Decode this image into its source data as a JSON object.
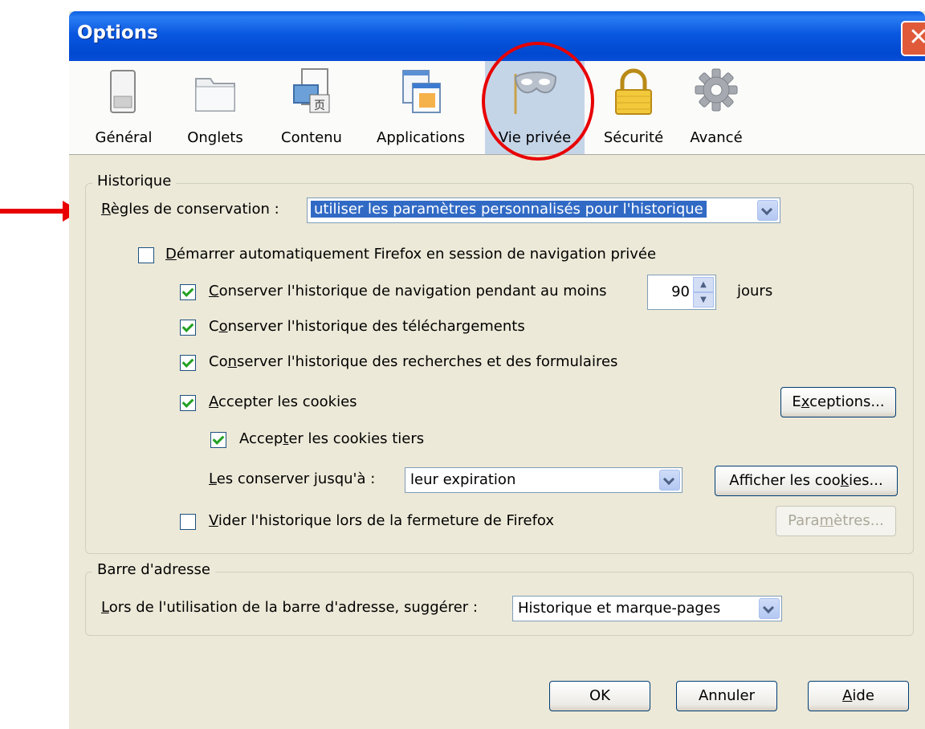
{
  "window": {
    "title": "Options",
    "close_glyph": "✕"
  },
  "tabs": [
    {
      "label": "Général",
      "icon": "general-icon"
    },
    {
      "label": "Onglets",
      "icon": "tabs-icon"
    },
    {
      "label": "Contenu",
      "icon": "content-icon"
    },
    {
      "label": "Applications",
      "icon": "applications-icon"
    },
    {
      "label": "Vie privée",
      "icon": "privacy-mask-icon",
      "selected": true
    },
    {
      "label": "Sécurité",
      "icon": "padlock-icon"
    },
    {
      "label": "Avancé",
      "icon": "gear-icon"
    }
  ],
  "history": {
    "legend": "Historique",
    "rules_label": "ègles de conservation :",
    "rules_u": "R",
    "rules_value": "utiliser les paramètres personnalisés pour l'historique",
    "autostart_u": "D",
    "autostart_label": "émarrer automatiquement Firefox en session de navigation privée",
    "autostart_checked": false,
    "keep_nav_u": "C",
    "keep_nav_label": "onserver l'historique de navigation pendant au moins",
    "keep_nav_checked": true,
    "days_value": "90",
    "days_unit": "jours",
    "keep_dl_pre": "C",
    "keep_dl_u": "o",
    "keep_dl_label": "nserver l'historique des téléchargements",
    "keep_dl_checked": true,
    "keep_search_pre": "Co",
    "keep_search_u": "n",
    "keep_search_label": "server l'historique des recherches et des formulaires",
    "keep_search_checked": true,
    "accept_cookies_u": "A",
    "accept_cookies_label": "ccepter les cookies",
    "accept_cookies_checked": true,
    "exceptions_pre": "E",
    "exceptions_u": "x",
    "exceptions_post": "ceptions...",
    "third_party_pre": "Accep",
    "third_party_u": "t",
    "third_party_label": "er les cookies tiers",
    "third_party_checked": true,
    "keep_until_u": "L",
    "keep_until_label": "es conserver jusqu'à :",
    "keep_until_value": "leur expiration",
    "show_cookies_pre": "Afficher les coo",
    "show_cookies_u": "k",
    "show_cookies_post": "ies...",
    "clear_u": "V",
    "clear_label": "ider l'historique lors de la fermeture de Firefox",
    "clear_checked": false,
    "settings_pre": "Para",
    "settings_u": "m",
    "settings_post": "ètres..."
  },
  "address_bar": {
    "legend": "Barre d'adresse",
    "suggest_u": "L",
    "suggest_label": "ors de l'utilisation de la barre d'adresse, suggérer :",
    "suggest_value": "Historique et marque-pages"
  },
  "buttons": {
    "ok": "OK",
    "cancel": "Annuler",
    "help_u": "A",
    "help_post": "ide"
  },
  "colors": {
    "title_bar": "#0a58e0",
    "dialog_bg": "#ece9d8",
    "selected_tab": "#c5d5e8",
    "annotation_red": "#e80000"
  }
}
